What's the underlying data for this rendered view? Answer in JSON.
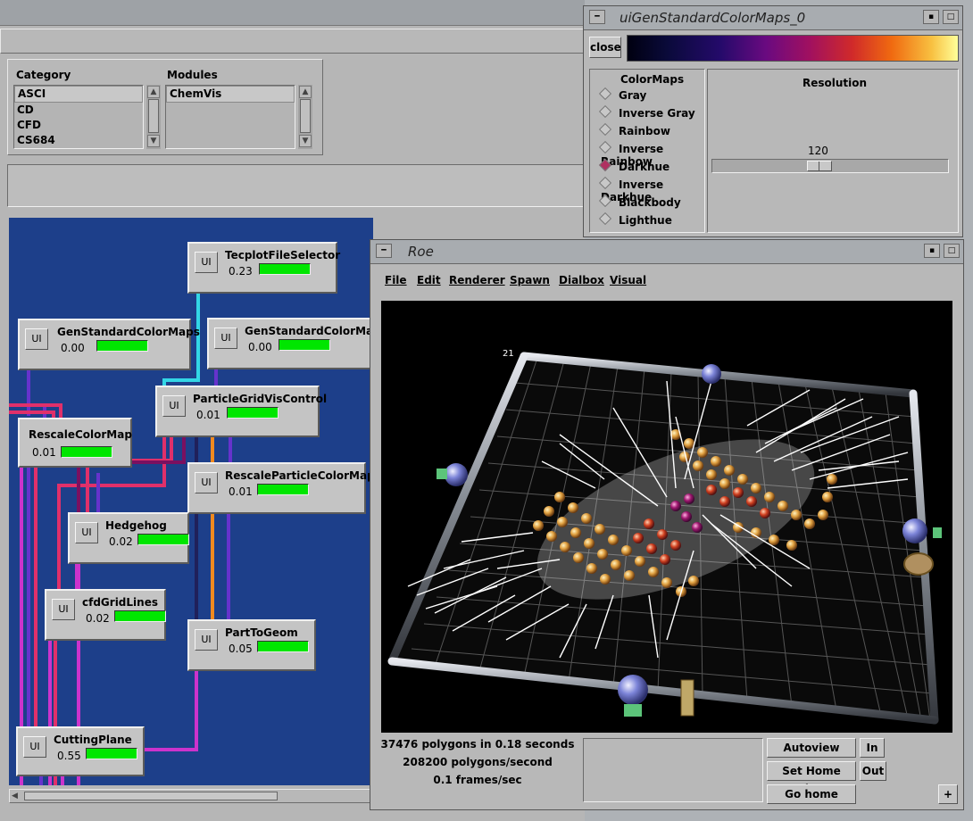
{
  "category": {
    "header": "Category",
    "items": [
      "ASCI",
      "CD",
      "CFD",
      "CS684"
    ],
    "selected": "ASCI"
  },
  "modules_list": {
    "header": "Modules",
    "items": [
      "ChemVis"
    ],
    "selected": "ChemVis"
  },
  "network": {
    "modules": [
      {
        "name": "TecplotFileSelector",
        "time": "0.23"
      },
      {
        "name": "GenStandardColorMaps",
        "time": "0.00"
      },
      {
        "name": "GenStandardColorMaps",
        "time": "0.00"
      },
      {
        "name": "ParticleGridVisControl",
        "time": "0.01"
      },
      {
        "name": "RescaleColorMap",
        "time": "0.01"
      },
      {
        "name": "RescaleParticleColorMap",
        "time": "0.01"
      },
      {
        "name": "Hedgehog",
        "time": "0.02"
      },
      {
        "name": "cfdGridLines",
        "time": "0.02"
      },
      {
        "name": "PartToGeom",
        "time": "0.05"
      },
      {
        "name": "CuttingPlane",
        "time": "0.55"
      }
    ],
    "ui_label": "UI",
    "progress_color": "#00e600",
    "canvas_color": "#1d3f8a"
  },
  "colormap_window": {
    "title": "uiGenStandardColorMaps_0",
    "close_label": "close",
    "colormaps_header": "ColorMaps",
    "options": [
      "Gray",
      "Inverse Gray",
      "Rainbow",
      "Inverse Rainbow",
      "Darkhue",
      "Inverse Darkhue",
      "Blackbody",
      "Lighthue"
    ],
    "selected": "Darkhue",
    "resolution_label": "Resolution",
    "resolution_value": "120"
  },
  "roe_window": {
    "title": "Roe",
    "menu": [
      "File",
      "Edit",
      "Renderer",
      "Spawn",
      "Dialbox",
      "Visual"
    ],
    "viewport_label": "21",
    "stats": [
      "37476 polygons in 0.18 seconds",
      "208200 polygons/second",
      "0.1 frames/sec"
    ],
    "buttons": {
      "autoview": "Autoview",
      "in": "In",
      "set_home": "Set Home View",
      "out": "Out",
      "go_home": "Go home",
      "plus": "+"
    }
  }
}
